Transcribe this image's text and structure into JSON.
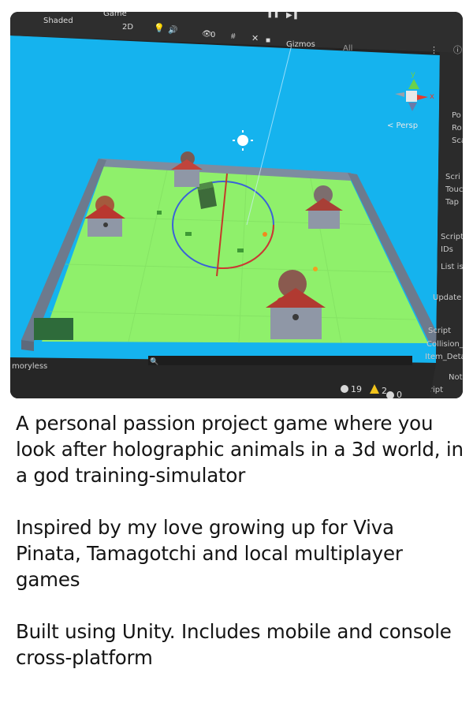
{
  "photo": {
    "toolbar": {
      "shading_mode": "Shaded",
      "game_tab": "Game",
      "mode_2d": "2D",
      "hidden_count": "0",
      "gizmos_label": "Gizmos",
      "search_placeholder": "All"
    },
    "scene": {
      "persp_label": "< Persp",
      "gizmo_y": "y",
      "gizmo_x": "x"
    },
    "project_panel": {
      "label": "moryless"
    },
    "status_bar": {
      "messages_count": "19",
      "warnings_count": "2",
      "errors_count": "0"
    },
    "inspector": {
      "rows": [
        "Po",
        "Ro",
        "Sca",
        "Scri",
        "Touc",
        "Tap",
        "Script",
        "IDs",
        "List is",
        "Update",
        "Script",
        "Collision_",
        "Item_Deta",
        "Not",
        "Script"
      ]
    },
    "colors": {
      "sky": "#14b4ee",
      "ground": "#8ef06a",
      "wall": "#7d8ca0",
      "editor_bg": "#282828"
    }
  },
  "caption": {
    "paragraph_1": "A personal passion project game where you look after holographic animals in a 3d world, in a god training-simulator",
    "paragraph_2": "Inspired by my love growing up for Viva Pinata, Tamagotchi and local multiplayer games",
    "paragraph_3": "Built using Unity. Includes mobile and console cross-platform"
  }
}
